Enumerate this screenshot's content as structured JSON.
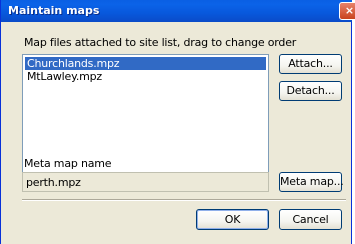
{
  "window": {
    "title": "Maintain maps",
    "close_label": "×"
  },
  "files": {
    "label": "Map files attached to site list, drag to change order",
    "items": [
      {
        "name": "Churchlands.mpz",
        "selected": true
      },
      {
        "name": "MtLawley.mpz",
        "selected": false
      }
    ],
    "attach_label": "Attach...",
    "detach_label": "Detach..."
  },
  "meta": {
    "label": "Meta map name",
    "value": "perth.mpz",
    "button_label": "Meta map..."
  },
  "footer": {
    "ok_label": "OK",
    "cancel_label": "Cancel"
  }
}
